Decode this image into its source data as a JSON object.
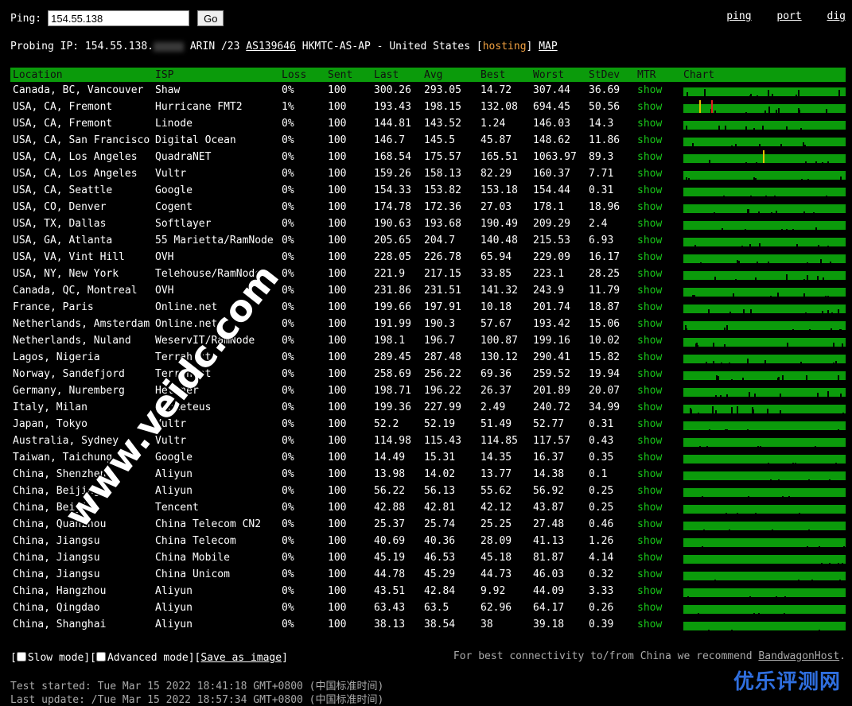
{
  "top": {
    "ping_label": "Ping:",
    "ip_value": "154.55.138",
    "go_label": "Go",
    "links": [
      "ping",
      "port",
      "dig"
    ]
  },
  "probe": {
    "prefix": "Probing IP: 154.55.138.",
    "registry": "ARIN /23",
    "asn": "AS139646",
    "org": "HKMTC-AS-AP - United States [",
    "hosting": "hosting",
    "close": "]",
    "map": "MAP"
  },
  "columns": [
    "Location",
    "ISP",
    "Loss",
    "Sent",
    "Last",
    "Avg",
    "Best",
    "Worst",
    "StDev",
    "MTR",
    "Chart"
  ],
  "colors": {
    "header_bg": "#0b9b0b",
    "chart_bar": "#0b9b0b",
    "show_link": "#19c819",
    "hosting": "#f0a040",
    "loss_mark_yellow": "#e8c000",
    "loss_mark_red": "#e02020"
  },
  "rows": [
    {
      "location": "Canada, BC, Vancouver",
      "isp": "Shaw",
      "loss": "0%",
      "sent": "100",
      "last": "300.26",
      "avg": "293.05",
      "best": "14.72",
      "worst": "307.44",
      "stdev": "36.69",
      "mtr": "show",
      "jitter": 0.9,
      "seed": 1,
      "marks": []
    },
    {
      "location": "USA, CA, Fremont",
      "isp": "Hurricane FMT2",
      "loss": "1%",
      "sent": "100",
      "last": "193.43",
      "avg": "198.15",
      "best": "132.08",
      "worst": "694.45",
      "stdev": "50.56",
      "mtr": "show",
      "jitter": 0.7,
      "seed": 2,
      "marks": [
        {
          "pos": 0.1,
          "color": "#e8c000"
        },
        {
          "pos": 0.17,
          "color": "#e02020"
        }
      ]
    },
    {
      "location": "USA, CA, Fremont",
      "isp": "Linode",
      "loss": "0%",
      "sent": "100",
      "last": "144.81",
      "avg": "143.52",
      "best": "1.24",
      "worst": "146.03",
      "stdev": "14.3",
      "mtr": "show",
      "jitter": 0.5,
      "seed": 3,
      "marks": []
    },
    {
      "location": "USA, CA, San Francisco",
      "isp": "Digital Ocean",
      "loss": "0%",
      "sent": "100",
      "last": "146.7",
      "avg": "145.5",
      "best": "45.87",
      "worst": "148.62",
      "stdev": "11.86",
      "mtr": "show",
      "jitter": 0.5,
      "seed": 4,
      "marks": []
    },
    {
      "location": "USA, CA, Los Angeles",
      "isp": "QuadraNET",
      "loss": "0%",
      "sent": "100",
      "last": "168.54",
      "avg": "175.57",
      "best": "165.51",
      "worst": "1063.97",
      "stdev": "89.3",
      "mtr": "show",
      "jitter": 0.4,
      "seed": 5,
      "marks": [
        {
          "pos": 0.49,
          "color": "#e8c000"
        }
      ]
    },
    {
      "location": "USA, CA, Los Angeles",
      "isp": "Vultr",
      "loss": "0%",
      "sent": "100",
      "last": "159.26",
      "avg": "158.13",
      "best": "82.29",
      "worst": "160.37",
      "stdev": "7.71",
      "mtr": "show",
      "jitter": 0.4,
      "seed": 6,
      "marks": []
    },
    {
      "location": "USA, CA, Seattle",
      "isp": "Google",
      "loss": "0%",
      "sent": "100",
      "last": "154.33",
      "avg": "153.82",
      "best": "153.18",
      "worst": "154.44",
      "stdev": "0.31",
      "mtr": "show",
      "jitter": 0.2,
      "seed": 7,
      "marks": []
    },
    {
      "location": "USA, CO, Denver",
      "isp": "Cogent",
      "loss": "0%",
      "sent": "100",
      "last": "174.78",
      "avg": "172.36",
      "best": "27.03",
      "worst": "178.1",
      "stdev": "18.96",
      "mtr": "show",
      "jitter": 0.5,
      "seed": 8,
      "marks": []
    },
    {
      "location": "USA, TX, Dallas",
      "isp": "Softlayer",
      "loss": "0%",
      "sent": "100",
      "last": "190.63",
      "avg": "193.68",
      "best": "190.49",
      "worst": "209.29",
      "stdev": "2.4",
      "mtr": "show",
      "jitter": 0.3,
      "seed": 9,
      "marks": []
    },
    {
      "location": "USA, GA, Atlanta",
      "isp": "55 Marietta/RamNode",
      "loss": "0%",
      "sent": "100",
      "last": "205.65",
      "avg": "204.7",
      "best": "140.48",
      "worst": "215.53",
      "stdev": "6.93",
      "mtr": "show",
      "jitter": 0.4,
      "seed": 10,
      "marks": []
    },
    {
      "location": "USA, VA, Vint Hill",
      "isp": "OVH",
      "loss": "0%",
      "sent": "100",
      "last": "228.05",
      "avg": "226.78",
      "best": "65.94",
      "worst": "229.09",
      "stdev": "16.17",
      "mtr": "show",
      "jitter": 0.5,
      "seed": 11,
      "marks": []
    },
    {
      "location": "USA, NY, New York",
      "isp": "Telehouse/RamNode",
      "loss": "0%",
      "sent": "100",
      "last": "221.9",
      "avg": "217.15",
      "best": "33.85",
      "worst": "223.1",
      "stdev": "28.25",
      "mtr": "show",
      "jitter": 0.6,
      "seed": 12,
      "marks": []
    },
    {
      "location": "Canada, QC, Montreal",
      "isp": "OVH",
      "loss": "0%",
      "sent": "100",
      "last": "231.86",
      "avg": "231.51",
      "best": "141.32",
      "worst": "243.9",
      "stdev": "11.79",
      "mtr": "show",
      "jitter": 0.5,
      "seed": 13,
      "marks": []
    },
    {
      "location": "France, Paris",
      "isp": "Online.net",
      "loss": "0%",
      "sent": "100",
      "last": "199.66",
      "avg": "197.91",
      "best": "10.18",
      "worst": "201.74",
      "stdev": "18.87",
      "mtr": "show",
      "jitter": 0.6,
      "seed": 14,
      "marks": []
    },
    {
      "location": "Netherlands, Amsterdam",
      "isp": "Online.net",
      "loss": "0%",
      "sent": "100",
      "last": "191.99",
      "avg": "190.3",
      "best": "57.67",
      "worst": "193.42",
      "stdev": "15.06",
      "mtr": "show",
      "jitter": 0.6,
      "seed": 15,
      "marks": []
    },
    {
      "location": "Netherlands, Nuland",
      "isp": "WeservIT/RamNode",
      "loss": "0%",
      "sent": "100",
      "last": "198.1",
      "avg": "196.7",
      "best": "100.87",
      "worst": "199.16",
      "stdev": "10.02",
      "mtr": "show",
      "jitter": 0.5,
      "seed": 16,
      "marks": []
    },
    {
      "location": "Lagos, Nigeria",
      "isp": "Terrahost",
      "loss": "0%",
      "sent": "100",
      "last": "289.45",
      "avg": "287.48",
      "best": "130.12",
      "worst": "290.41",
      "stdev": "15.82",
      "mtr": "show",
      "jitter": 0.6,
      "seed": 17,
      "marks": []
    },
    {
      "location": "Norway, Sandefjord",
      "isp": "Terrahost",
      "loss": "0%",
      "sent": "100",
      "last": "258.69",
      "avg": "256.22",
      "best": "69.36",
      "worst": "259.52",
      "stdev": "19.94",
      "mtr": "show",
      "jitter": 0.6,
      "seed": 18,
      "marks": []
    },
    {
      "location": "Germany, Nuremberg",
      "isp": "Hetzner",
      "loss": "0%",
      "sent": "100",
      "last": "198.71",
      "avg": "196.22",
      "best": "26.37",
      "worst": "201.89",
      "stdev": "20.07",
      "mtr": "show",
      "jitter": 0.6,
      "seed": 19,
      "marks": []
    },
    {
      "location": "Italy, Milan",
      "isp": "Prometeus",
      "loss": "0%",
      "sent": "100",
      "last": "199.36",
      "avg": "227.99",
      "best": "2.49",
      "worst": "240.72",
      "stdev": "34.99",
      "mtr": "show",
      "jitter": 0.9,
      "seed": 20,
      "marks": []
    },
    {
      "location": "Japan, Tokyo",
      "isp": "Vultr",
      "loss": "0%",
      "sent": "100",
      "last": "52.2",
      "avg": "52.19",
      "best": "51.49",
      "worst": "52.77",
      "stdev": "0.31",
      "mtr": "show",
      "jitter": 0.15,
      "seed": 21,
      "marks": []
    },
    {
      "location": "Australia, Sydney",
      "isp": "Vultr",
      "loss": "0%",
      "sent": "100",
      "last": "114.98",
      "avg": "115.43",
      "best": "114.85",
      "worst": "117.57",
      "stdev": "0.43",
      "mtr": "show",
      "jitter": 0.15,
      "seed": 22,
      "marks": []
    },
    {
      "location": "Taiwan, Taichung",
      "isp": "Google",
      "loss": "0%",
      "sent": "100",
      "last": "14.49",
      "avg": "15.31",
      "best": "14.35",
      "worst": "16.37",
      "stdev": "0.35",
      "mtr": "show",
      "jitter": 0.05,
      "seed": 23,
      "marks": []
    },
    {
      "location": "China, Shenzhen",
      "isp": "Aliyun",
      "loss": "0%",
      "sent": "100",
      "last": "13.98",
      "avg": "14.02",
      "best": "13.77",
      "worst": "14.38",
      "stdev": "0.1",
      "mtr": "show",
      "jitter": 0.05,
      "seed": 24,
      "marks": []
    },
    {
      "location": "China, Beijing",
      "isp": "Aliyun",
      "loss": "0%",
      "sent": "100",
      "last": "56.22",
      "avg": "56.13",
      "best": "55.62",
      "worst": "56.92",
      "stdev": "0.25",
      "mtr": "show",
      "jitter": 0.05,
      "seed": 25,
      "marks": []
    },
    {
      "location": "China, Beijing",
      "isp": "Tencent",
      "loss": "0%",
      "sent": "100",
      "last": "42.88",
      "avg": "42.81",
      "best": "42.12",
      "worst": "43.87",
      "stdev": "0.25",
      "mtr": "show",
      "jitter": 0.05,
      "seed": 26,
      "marks": []
    },
    {
      "location": "China, Quanzhou",
      "isp": "China Telecom CN2",
      "loss": "0%",
      "sent": "100",
      "last": "25.37",
      "avg": "25.74",
      "best": "25.25",
      "worst": "27.48",
      "stdev": "0.46",
      "mtr": "show",
      "jitter": 0.05,
      "seed": 27,
      "marks": []
    },
    {
      "location": "China, Jiangsu",
      "isp": "China Telecom",
      "loss": "0%",
      "sent": "100",
      "last": "40.69",
      "avg": "40.36",
      "best": "28.09",
      "worst": "41.13",
      "stdev": "1.26",
      "mtr": "show",
      "jitter": 0.05,
      "seed": 28,
      "marks": []
    },
    {
      "location": "China, Jiangsu",
      "isp": "China Mobile",
      "loss": "0%",
      "sent": "100",
      "last": "45.19",
      "avg": "46.53",
      "best": "45.18",
      "worst": "81.87",
      "stdev": "4.14",
      "mtr": "show",
      "jitter": 0.05,
      "seed": 29,
      "marks": []
    },
    {
      "location": "China, Jiangsu",
      "isp": "China Unicom",
      "loss": "0%",
      "sent": "100",
      "last": "44.78",
      "avg": "45.29",
      "best": "44.73",
      "worst": "46.03",
      "stdev": "0.32",
      "mtr": "show",
      "jitter": 0.05,
      "seed": 30,
      "marks": []
    },
    {
      "location": "China, Hangzhou",
      "isp": "Aliyun",
      "loss": "0%",
      "sent": "100",
      "last": "43.51",
      "avg": "42.84",
      "best": "9.92",
      "worst": "44.09",
      "stdev": "3.33",
      "mtr": "show",
      "jitter": 0.05,
      "seed": 31,
      "marks": []
    },
    {
      "location": "China, Qingdao",
      "isp": "Aliyun",
      "loss": "0%",
      "sent": "100",
      "last": "63.43",
      "avg": "63.5",
      "best": "62.96",
      "worst": "64.17",
      "stdev": "0.26",
      "mtr": "show",
      "jitter": 0.05,
      "seed": 32,
      "marks": []
    },
    {
      "location": "China, Shanghai",
      "isp": "Aliyun",
      "loss": "0%",
      "sent": "100",
      "last": "38.13",
      "avg": "38.54",
      "best": "38",
      "worst": "39.18",
      "stdev": "0.39",
      "mtr": "show",
      "jitter": 0.05,
      "seed": 33,
      "marks": []
    }
  ],
  "options": {
    "slow_mode": "Slow mode",
    "advanced_mode": "Advanced mode",
    "save_image": "Save as image"
  },
  "recommend": {
    "text": "For best connectivity to/from China we recommend ",
    "link": "BandwagonHost",
    "end": "."
  },
  "times": {
    "started": "Test started: Tue Mar 15 2022 18:41:18 GMT+0800 (中国标准时间)",
    "updated": "Last update: /Tue Mar 15 2022 18:57:34 GMT+0800 (中国标准时间)"
  },
  "watermark": "www.veidc.com",
  "brand": "优乐评测网"
}
